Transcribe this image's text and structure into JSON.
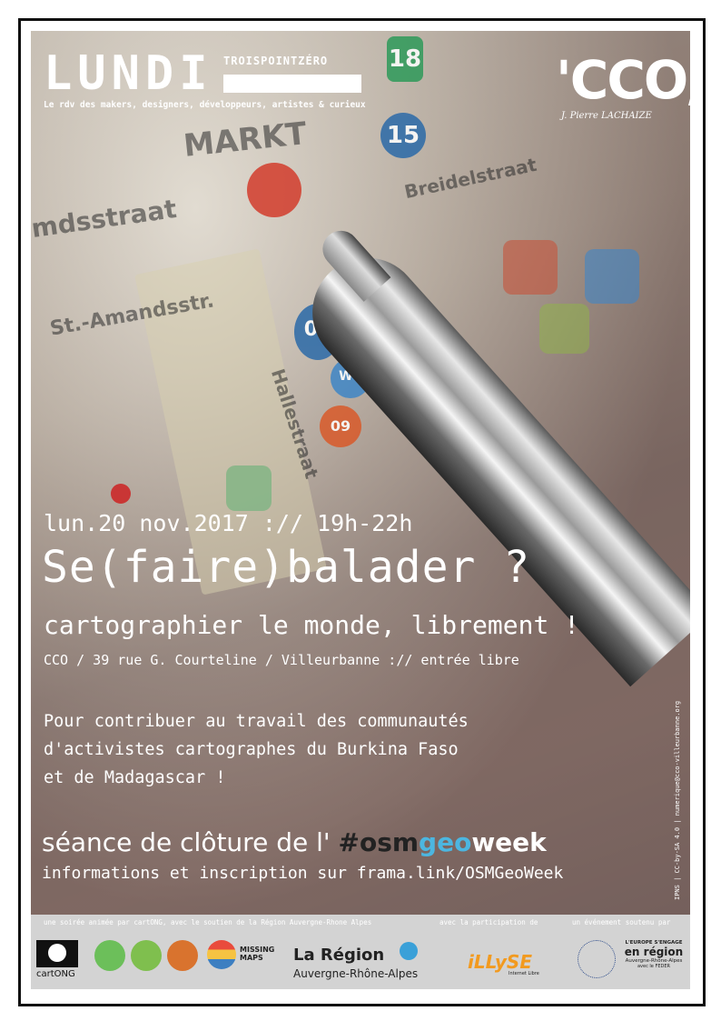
{
  "header": {
    "brand": "LUNDI",
    "brand_sub": "TROISPOINTZÉRO",
    "tagline": "Le rdv des makers, designers, développeurs, artistes & curieux",
    "venue_logo": "'CCO,",
    "venue_logo_sub": "J. Pierre LACHAIZE"
  },
  "event": {
    "date": "lun.20 nov.2017 :// 19h-22h",
    "title": "Se(faire)balader ?",
    "subtitle": "cartographier le monde, librement !",
    "place": "CCO / 39 rue G. Courteline / Villeurbanne :// entrée libre",
    "desc_line1": "Pour contribuer au travail des communautés",
    "desc_line2": "d'activistes cartographes du Burkina Faso",
    "desc_line3": "et de Madagascar !",
    "seance_prefix": "séance de clôture de l' ",
    "hashtag_hash": "#",
    "hashtag_osm": "osm",
    "hashtag_geo": "geo",
    "hashtag_week": "week",
    "info": "informations et inscription sur frama.link/OSMGeoWeek",
    "side_credit": "IPNS | CC-by-SA 4.0 | numerique@cco-villeurbanne.org"
  },
  "map_words": {
    "markt": "MARKT",
    "amandsstraat": "mdsstraat",
    "amandsstr": "St.-Amandsstr.",
    "halle": "Hallestraat",
    "breidel": "Breidelstraat",
    "num18": "18",
    "num15": "15",
    "num05": "05",
    "wc": "WC",
    "num09": "09"
  },
  "footer": {
    "cap_left": "une soirée animée par cartONG, avec le soutien de la Région Auvergne-Rhone Alpes",
    "cap_mid": "avec la participation de",
    "cap_right": "un événement soutenu par",
    "cartong": "cartONG",
    "missing_maps": "MISSING MAPS",
    "region_name": "La Région",
    "region_sub": "Auvergne-Rhône-Alpes",
    "illyse": "iLLySE",
    "illyse_sub": "Internet Libre",
    "europe_line1": "L'EUROPE S'ENGAGE",
    "europe_line2": "en région",
    "europe_line3": "Auvergne-Rhône-Alpes",
    "europe_line4": "avec le FEDER"
  },
  "colors": {
    "geo": "#4cb6e0",
    "illyse": "#f29a1f"
  }
}
